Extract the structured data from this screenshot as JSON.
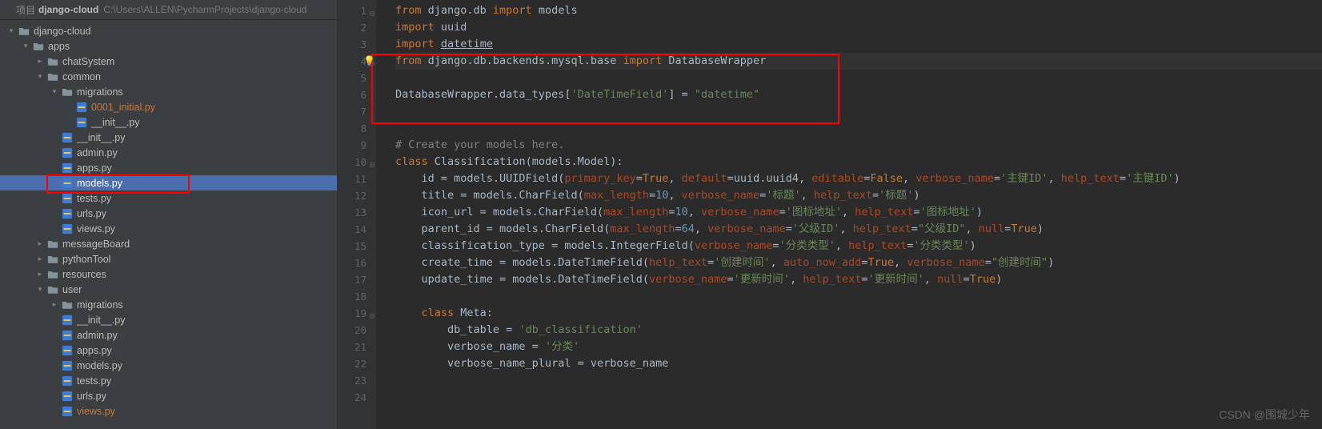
{
  "project": {
    "name": "django-cloud",
    "path": "C:\\Users\\ALLEN\\PycharmProjects\\django-cloud",
    "prefix": "项目"
  },
  "tree": [
    {
      "depth": 0,
      "kind": "root",
      "label": "django-cloud",
      "chev": "down"
    },
    {
      "depth": 1,
      "kind": "folder",
      "label": "apps",
      "chev": "down"
    },
    {
      "depth": 2,
      "kind": "folder",
      "label": "chatSystem",
      "chev": "right"
    },
    {
      "depth": 2,
      "kind": "folder",
      "label": "common",
      "chev": "down"
    },
    {
      "depth": 3,
      "kind": "folder",
      "label": "migrations",
      "chev": "down"
    },
    {
      "depth": 4,
      "kind": "py",
      "label": "0001_initial.py",
      "orange": true
    },
    {
      "depth": 4,
      "kind": "py",
      "label": "__init__.py"
    },
    {
      "depth": 3,
      "kind": "py",
      "label": "__init__.py"
    },
    {
      "depth": 3,
      "kind": "py",
      "label": "admin.py"
    },
    {
      "depth": 3,
      "kind": "py",
      "label": "apps.py"
    },
    {
      "depth": 3,
      "kind": "py",
      "label": "models.py",
      "selected": true
    },
    {
      "depth": 3,
      "kind": "py",
      "label": "tests.py"
    },
    {
      "depth": 3,
      "kind": "py",
      "label": "urls.py"
    },
    {
      "depth": 3,
      "kind": "py",
      "label": "views.py"
    },
    {
      "depth": 2,
      "kind": "folder",
      "label": "messageBoard",
      "chev": "right"
    },
    {
      "depth": 2,
      "kind": "folder",
      "label": "pythonTool",
      "chev": "right"
    },
    {
      "depth": 2,
      "kind": "folder",
      "label": "resources",
      "chev": "right"
    },
    {
      "depth": 2,
      "kind": "folder",
      "label": "user",
      "chev": "down"
    },
    {
      "depth": 3,
      "kind": "folder",
      "label": "migrations",
      "chev": "right"
    },
    {
      "depth": 3,
      "kind": "py",
      "label": "__init__.py"
    },
    {
      "depth": 3,
      "kind": "py",
      "label": "admin.py"
    },
    {
      "depth": 3,
      "kind": "py",
      "label": "apps.py"
    },
    {
      "depth": 3,
      "kind": "py",
      "label": "models.py"
    },
    {
      "depth": 3,
      "kind": "py",
      "label": "tests.py"
    },
    {
      "depth": 3,
      "kind": "py",
      "label": "urls.py"
    },
    {
      "depth": 3,
      "kind": "py",
      "label": "views.py",
      "orange": true
    }
  ],
  "code": {
    "lines": [
      {
        "n": 1,
        "fold": "down",
        "html": "<span class='kw'>from</span> django.db <span class='kw'>import</span> models"
      },
      {
        "n": 2,
        "html": "<span class='kw'>import</span> uuid"
      },
      {
        "n": 3,
        "html": "<span class='kw'>import</span> <span style='text-decoration:underline'>datetime</span>"
      },
      {
        "n": 4,
        "hl": true,
        "bulb": true,
        "fold": "down",
        "html": "<span class='kw'>from</span> django.db.backends.mysql.base <span class='kw'>import</span> DatabaseWrapper"
      },
      {
        "n": 5,
        "html": ""
      },
      {
        "n": 6,
        "html": "DatabaseWrapper.data_types[<span class='st'>'DateTimeField'</span>] = <span class='st'>\"datetime\"</span>"
      },
      {
        "n": 7,
        "html": ""
      },
      {
        "n": 8,
        "html": ""
      },
      {
        "n": 9,
        "html": "<span class='cm'># Create your models here.</span>"
      },
      {
        "n": 10,
        "fold": "down",
        "html": "<span class='kw'>class </span><span class='cls-name'>Classification</span>(models.Model):"
      },
      {
        "n": 11,
        "html": "    id = models.UUIDField(<span class='arg'>primary_key</span>=<span class='kw'>True</span>, <span class='arg'>default</span>=uuid.uuid4, <span class='arg'>editable</span>=<span class='kw'>False</span>, <span class='arg'>verbose_name</span>=<span class='st'>'主键ID'</span>, <span class='arg'>help_text</span>=<span class='st'>'主键ID'</span>)"
      },
      {
        "n": 12,
        "html": "    title = models.CharField(<span class='arg'>max_length</span>=<span class='num'>10</span>, <span class='arg'>verbose_name</span>=<span class='st'>'标题'</span>, <span class='arg'>help_text</span>=<span class='st'>'标题'</span>)"
      },
      {
        "n": 13,
        "html": "    icon_url = models.CharField(<span class='arg'>max_length</span>=<span class='num'>10</span>, <span class='arg'>verbose_name</span>=<span class='st'>'图标地址'</span>, <span class='arg'>help_text</span>=<span class='st'>'图标地址'</span>)"
      },
      {
        "n": 14,
        "html": "    parent_id = models.CharField(<span class='arg'>max_length</span>=<span class='num'>64</span>, <span class='arg'>verbose_name</span>=<span class='st'>'父级ID'</span>, <span class='arg'>help_text</span>=<span class='st'>\"父级ID\"</span>, <span class='arg'>null</span>=<span class='kw'>True</span>)"
      },
      {
        "n": 15,
        "html": "    classification_type = models.IntegerField(<span class='arg'>verbose_name</span>=<span class='st'>'分类类型'</span>, <span class='arg'>help_text</span>=<span class='st'>'分类类型'</span>)"
      },
      {
        "n": 16,
        "html": "    create_time = models.DateTimeField(<span class='arg'>help_text</span>=<span class='st'>'创建时间'</span>, <span class='arg'>auto_now_add</span>=<span class='kw'>True</span>, <span class='arg'>verbose_name</span>=<span class='st'>\"创建时间\"</span>)"
      },
      {
        "n": 17,
        "html": "    update_time = models.DateTimeField(<span class='arg'>verbose_name</span>=<span class='st'>'更新时间'</span>, <span class='arg'>help_text</span>=<span class='st'>'更新时间'</span>, <span class='arg'>null</span>=<span class='kw'>True</span>)"
      },
      {
        "n": 18,
        "html": ""
      },
      {
        "n": 19,
        "fold": "down",
        "html": "    <span class='kw'>class </span>Meta:"
      },
      {
        "n": 20,
        "html": "        db_table = <span class='st'>'db_classification'</span>"
      },
      {
        "n": 21,
        "html": "        verbose_name = <span class='st'>'分类'</span>"
      },
      {
        "n": 22,
        "html": "        verbose_name_plural = verbose_name"
      },
      {
        "n": 23,
        "html": ""
      },
      {
        "n": 24,
        "html": ""
      }
    ]
  },
  "watermark": "CSDN @围城少年"
}
